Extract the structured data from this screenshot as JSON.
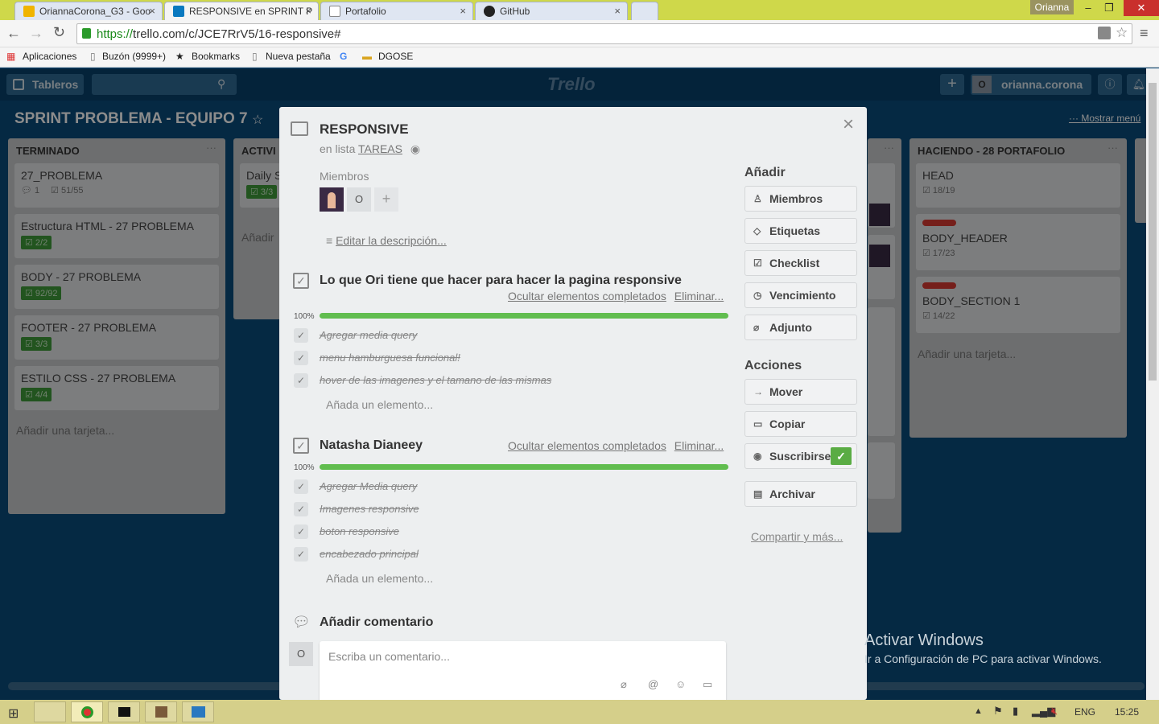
{
  "browser": {
    "tabs": [
      {
        "label": "OriannaCorona_G3 - Goo",
        "icon_color": "#f0b400"
      },
      {
        "label": "RESPONSIVE en SPRINT P",
        "icon_color": "#0a79bf"
      },
      {
        "label": "Portafolio",
        "icon_color": "#888888"
      },
      {
        "label": "GitHub",
        "icon_color": "#222222"
      }
    ],
    "user_badge": "Orianna",
    "url_scheme": "https://",
    "url_rest": "trello.com/c/JCE7RrV5/16-responsive#",
    "bookmarks": [
      "Aplicaciones",
      "Buzón (9999+)",
      "Bookmarks",
      "Nueva pestaña",
      "DGOSE"
    ]
  },
  "trello": {
    "boards_button": "Tableros",
    "logo": "Trello",
    "user_initial": "O",
    "username": "orianna.corona",
    "board_title": "SPRINT PROBLEMA - EQUIPO 7",
    "show_menu": "Mostrar menú",
    "lists": [
      {
        "title": "TERMINADO",
        "cards": [
          {
            "title": "27_PROBLEMA",
            "comments": "1",
            "checklist": "51/55"
          },
          {
            "title": "Estructura HTML - 27 PROBLEMA",
            "checklist": "2/2"
          },
          {
            "title": "BODY - 27 PROBLEMA",
            "checklist": "92/92"
          },
          {
            "title": "FOOTER - 27 PROBLEMA",
            "checklist": "3/3"
          },
          {
            "title": "ESTILO CSS - 27 PROBLEMA",
            "checklist": "4/4"
          }
        ],
        "add": "Añadir una tarjeta..."
      },
      {
        "title": "ACTIVI",
        "cards": [
          {
            "title": "Daily S",
            "checklist": "3/3"
          }
        ],
        "add": "Añadir"
      },
      {
        "title": "HACIENDO - 28 PORTAFOLIO",
        "cards": [
          {
            "title": "HEAD",
            "checklist": "18/19"
          },
          {
            "title": "BODY_HEADER",
            "checklist": "17/23"
          },
          {
            "title": "BODY_SECTION 1",
            "checklist": "14/22"
          }
        ],
        "add": "Añadir una tarjeta..."
      }
    ]
  },
  "card": {
    "title": "RESPONSIVE",
    "in_list_prefix": "en lista",
    "list_name": "TAREAS",
    "members_label": "Miembros",
    "member_initial": "O",
    "edit_description": "Editar la descripción...",
    "checklists": [
      {
        "title": "Lo que Ori tiene que hacer para hacer la pagina responsive",
        "percent": "100%",
        "progress": 1.0,
        "hide_completed": "Ocultar elementos completados",
        "delete": "Eliminar...",
        "items": [
          "Agregar media query",
          "menu hamburguesa funcional!",
          "hover de las imagenes y el tamano de las mismas"
        ],
        "add_item": "Añada un elemento..."
      },
      {
        "title": "Natasha Dianeey",
        "percent": "100%",
        "progress": 1.0,
        "hide_completed": "Ocultar elementos completados",
        "delete": "Eliminar...",
        "items": [
          "Agregar Media query",
          "Imagenes responsive",
          "boton responsive",
          "encabezado principal"
        ],
        "add_item": "Añada un elemento..."
      }
    ],
    "add_comment_title": "Añadir comentario",
    "comment_placeholder": "Escriba un comentario...",
    "sidebar": {
      "add_title": "Añadir",
      "add_buttons": [
        "Miembros",
        "Etiquetas",
        "Checklist",
        "Vencimiento",
        "Adjunto"
      ],
      "actions_title": "Acciones",
      "action_buttons": [
        "Mover",
        "Copiar",
        "Suscribirse",
        "Archivar"
      ],
      "share": "Compartir y más..."
    }
  },
  "watermark": {
    "line1": "Activar Windows",
    "line2": "Ir a Configuración de PC para activar Windows."
  },
  "taskbar": {
    "lang": "ENG",
    "time": "15:25"
  }
}
